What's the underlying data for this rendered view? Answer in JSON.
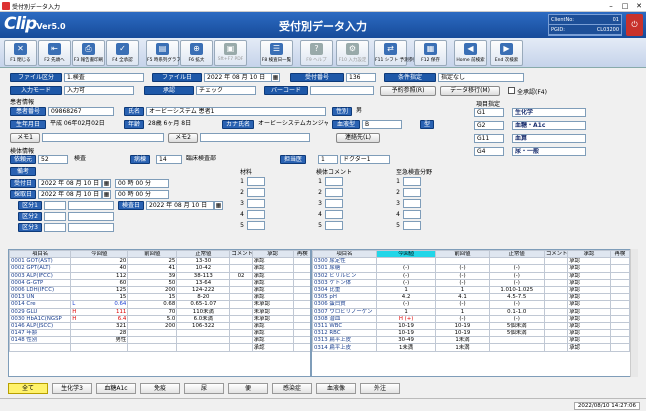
{
  "window": {
    "title": "受付別データ入力"
  },
  "header": {
    "logo": "Clip",
    "version": "Ver5.0",
    "title": "受付別データ入力",
    "client_label": "ClientNo:",
    "client_value": "01",
    "pgid_label": "PGID:",
    "pgid_value": "CL03200"
  },
  "toolbar": [
    {
      "key": "F1",
      "label": "F1 閉じる",
      "icon": "close-icon",
      "enabled": true
    },
    {
      "key": "F2",
      "label": "F2 先頭へ",
      "icon": "first-icon",
      "enabled": true
    },
    {
      "key": "F3",
      "label": "F3 報告書印刷",
      "icon": "print-icon",
      "enabled": true
    },
    {
      "key": "F4",
      "label": "F4 全承認",
      "icon": "approve-icon",
      "enabled": true
    },
    {
      "key": "F5",
      "label": "F5 時系列グラフ",
      "icon": "graph-icon",
      "enabled": true
    },
    {
      "key": "F6",
      "label": "F6 拡大",
      "icon": "zoom-icon",
      "enabled": true
    },
    {
      "key": "F7",
      "label": "Sft+F7 PDF",
      "icon": "pdf-icon",
      "enabled": false
    },
    {
      "key": "F8",
      "label": "F8 検査日一覧",
      "icon": "list-icon",
      "enabled": true
    },
    {
      "key": "F9",
      "label": "F9 ヘルプ",
      "icon": "help-icon",
      "enabled": false
    },
    {
      "key": "F10",
      "label": "F10 入力設定",
      "icon": "settings-icon",
      "enabled": false
    },
    {
      "key": "F11",
      "label": "F11 シフト 予測参照",
      "icon": "car-icon",
      "enabled": true
    },
    {
      "key": "F12",
      "label": "F12 保存",
      "icon": "save-icon",
      "enabled": true
    },
    {
      "key": "Home",
      "label": "Home 前検索",
      "icon": "prev-icon",
      "enabled": true
    },
    {
      "key": "End",
      "label": "End 次検索",
      "icon": "next-icon",
      "enabled": true
    }
  ],
  "search": {
    "file_kubun_label": "ファイル区分",
    "file_kubun_value": "1.検査",
    "file_date_label": "ファイル日",
    "file_date_value": "2022 年 08 月 10 日",
    "uketsuke_label": "受付番号",
    "uketsuke_value": "136",
    "cond_label": "条件指定",
    "cond_value": "指定なし",
    "input_mode_label": "入力モード",
    "input_mode_value": "入力可",
    "approve_label": "承認",
    "approve_value": "チェック",
    "barcode_label": "バーコード",
    "barcode_value": "",
    "yoyaku_btn": "予約参照(R)",
    "data_move_btn": "データ移行(M)",
    "all_approve_label": "全承認(F4)"
  },
  "patient": {
    "section": "患者情報",
    "id_label": "患者番号",
    "id_value": "09868267",
    "name_label": "氏名",
    "name_value": "オービーシステム 患者1",
    "sex_label": "性別",
    "sex_value": "男",
    "dob_label": "生年月日",
    "dob_value": "平成 06年02月02日",
    "age_label": "年齢",
    "age_value": "28歳 6ヶ月 8日",
    "kana_label": "カナ氏名",
    "kana_value": "オービーシステムカンジャ1",
    "blood_label": "血液型",
    "blood_value": "B",
    "type_label": "型",
    "memo1_label": "メモ1",
    "memo2_label": "メモ2",
    "contact_label": "連絡先(L)"
  },
  "item_spec": {
    "section": "項目指定",
    "codes": [
      "G1",
      "G2",
      "G11",
      "G4"
    ],
    "names": [
      "生化学",
      "血糖・A1c",
      "血算",
      "尿・一般"
    ]
  },
  "specimen": {
    "section": "検体情報",
    "irai_label": "依頼元",
    "irai_code": "52",
    "irai_value": "検査",
    "ward_label": "病棟",
    "ward_value": "14",
    "ward_name": "臨床検査部",
    "doctor_label": "担当医",
    "doctor_code": "1",
    "doctor_value": "ドクター1",
    "bikou_label": "備考",
    "uketsuke_date_label": "受付日",
    "uketsuke_date_value": "2022 年 08 月 10 日",
    "uketsuke_time": "00 時 00 分",
    "saiketsu_label": "採取日",
    "saiketsu_date_value": "2022 年 08 月 10 日",
    "saiketsu_time": "00 時 00 分",
    "kubun1_label": "区分1",
    "kubun2_label": "区分2",
    "kubun3_label": "区分3",
    "kensa_date_label": "検査日",
    "kensa_date_value": "2022 年 08 月 10 日",
    "zairyo_label": "材料",
    "comment_label": "検体コメント",
    "urgent_label": "至急検査分野"
  },
  "results": {
    "headers": [
      "項目名",
      "今回値",
      "前回値",
      "正常値",
      "コメント1",
      "承認",
      "再検"
    ],
    "left": [
      {
        "name": "0001 GOT(AST)",
        "cur": "20",
        "prev": "25",
        "normal": "13-30",
        "cmt": "",
        "appr": "承認",
        "flag": ""
      },
      {
        "name": "0002 GPT(ALT)",
        "cur": "40",
        "prev": "41",
        "normal": "10-42",
        "cmt": "",
        "appr": "承認",
        "flag": ""
      },
      {
        "name": "0003 ALP(IFCC)",
        "cur": "112",
        "prev": "39",
        "normal": "38-113",
        "cmt": "02",
        "appr": "承認",
        "flag": ""
      },
      {
        "name": "0004 G-GTP",
        "cur": "60",
        "prev": "50",
        "normal": "13-64",
        "cmt": "",
        "appr": "承認",
        "flag": ""
      },
      {
        "name": "0006 LDH(IFCC)",
        "cur": "125",
        "prev": "200",
        "normal": "124-222",
        "cmt": "",
        "appr": "承認",
        "flag": ""
      },
      {
        "name": "0013 UN",
        "cur": "15",
        "prev": "15",
        "normal": "8-20",
        "cmt": "",
        "appr": "承認",
        "flag": ""
      },
      {
        "name": "0014 Cre",
        "cur": "0.64",
        "prev": "0.68",
        "normal": "0.65-1.07",
        "cmt": "",
        "appr": "未承認",
        "flag": "L"
      },
      {
        "name": "0029 GLU",
        "cur": "111",
        "prev": "70",
        "normal": "110未満",
        "cmt": "",
        "appr": "未承認",
        "flag": "H"
      },
      {
        "name": "0030 HbA1C(NGSP",
        "cur": "6.4",
        "prev": "5.0",
        "normal": "6.0未満",
        "cmt": "",
        "appr": "未承認",
        "flag": "H"
      },
      {
        "name": "0146 ALP(JSCC)",
        "cur": "321",
        "prev": "200",
        "normal": "106-322",
        "cmt": "",
        "appr": "承認",
        "flag": ""
      },
      {
        "name": "0147 年齢",
        "cur": "28",
        "prev": "",
        "normal": "",
        "cmt": "",
        "appr": "承認",
        "flag": ""
      },
      {
        "name": "0148 性別",
        "cur": "男性",
        "prev": "",
        "normal": "",
        "cmt": "",
        "appr": "承認",
        "flag": ""
      },
      {
        "name": "",
        "cur": "",
        "prev": "",
        "normal": "",
        "cmt": "",
        "appr": "承認",
        "flag": ""
      }
    ],
    "right": [
      {
        "name": "0300 尿定性",
        "cur": "",
        "prev": "",
        "normal": "",
        "appr": "承認"
      },
      {
        "name": "0301 尿糖",
        "cur": "(-)",
        "prev": "(-)",
        "normal": "(-)",
        "appr": "承認"
      },
      {
        "name": "0302 ビリルビン",
        "cur": "(-)",
        "prev": "(-)",
        "normal": "(-)",
        "appr": "承認"
      },
      {
        "name": "0303 ケトン体",
        "cur": "(-)",
        "prev": "(-)",
        "normal": "(-)",
        "appr": "承認"
      },
      {
        "name": "0304 比重",
        "cur": "1",
        "prev": "1",
        "normal": "1.010-1.025",
        "appr": "承認"
      },
      {
        "name": "0305 pH",
        "cur": "4.2",
        "prev": "4.1",
        "normal": "4.5-7.5",
        "appr": "承認"
      },
      {
        "name": "0306 蛋白質",
        "cur": "(-)",
        "prev": "(-)",
        "normal": "(-)",
        "appr": "承認"
      },
      {
        "name": "0307 ウロビリノーゲン",
        "cur": "1",
        "prev": "1",
        "normal": "0.1-1.0",
        "appr": "承認"
      },
      {
        "name": "0308 潜血",
        "cur": "H (+)",
        "prev": "(-)",
        "normal": "(-)",
        "appr": "承認"
      },
      {
        "name": "0311 WBC",
        "cur": "10-19",
        "prev": "10-19",
        "normal": "5個未満",
        "appr": "承認"
      },
      {
        "name": "0312 RBC",
        "cur": "10-19",
        "prev": "10-19",
        "normal": "5個未満",
        "appr": "承認"
      },
      {
        "name": "0313 扁平上皮",
        "cur": "30-49",
        "prev": "1未満",
        "normal": "",
        "appr": "承認"
      },
      {
        "name": "0314 扁平上皮",
        "cur": "1未満",
        "prev": "1未満",
        "normal": "",
        "appr": "承認"
      }
    ]
  },
  "tabs": [
    "全て",
    "生化学3",
    "血糖A1c",
    "免疫",
    "尿",
    "便",
    "感染症",
    "血液像",
    "外注"
  ],
  "status": {
    "datetime": "2022/08/10  14:27:06"
  }
}
